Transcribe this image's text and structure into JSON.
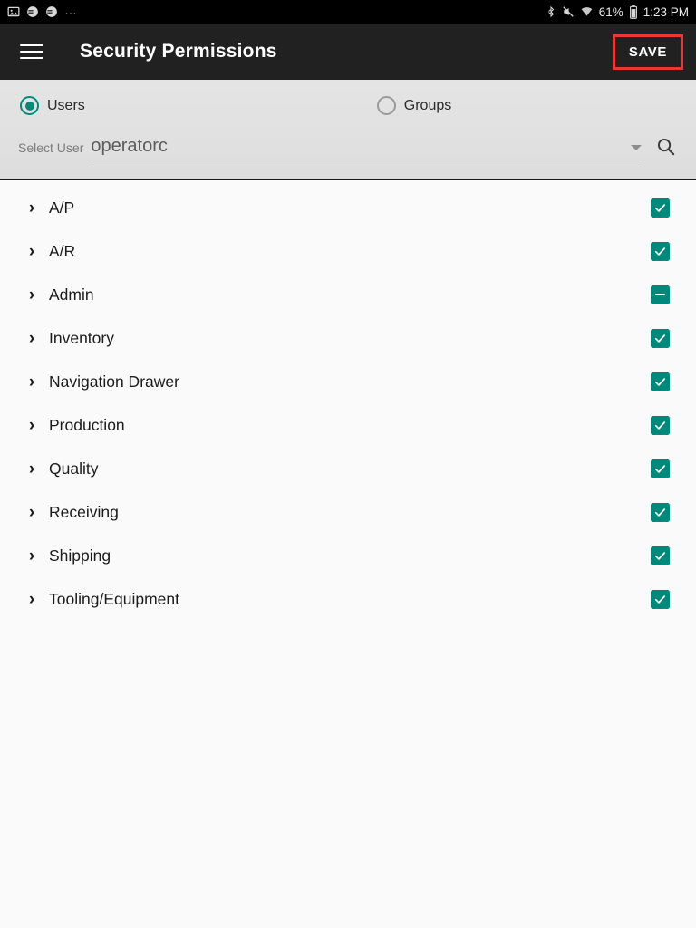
{
  "status_bar": {
    "left_icons": [
      "image-icon",
      "app-notification-icon",
      "app-notification-icon"
    ],
    "overflow_dots": "…",
    "right_icons": [
      "bluetooth-icon",
      "vibrate-mute-icon",
      "wifi-icon"
    ],
    "battery_percent": "61%",
    "time": "1:23 PM"
  },
  "app_bar": {
    "menu_icon": "hamburger-menu-icon",
    "title": "Security Permissions",
    "save_label": "SAVE",
    "highlight_color": "#e53935",
    "background": "#212121"
  },
  "selector": {
    "radio_users": {
      "label": "Users",
      "selected": true
    },
    "radio_groups": {
      "label": "Groups",
      "selected": false
    },
    "select_user_label": "Select User",
    "selected_user": "operatorc",
    "dropdown_icon": "chevron-down-icon",
    "search_icon": "search-icon",
    "accent_color": "#00897b"
  },
  "permissions": {
    "accent_color": "#00897b",
    "rows": [
      {
        "label": "A/P",
        "state": "checked",
        "expand_icon": "chevron-right-icon"
      },
      {
        "label": "A/R",
        "state": "checked",
        "expand_icon": "chevron-right-icon"
      },
      {
        "label": "Admin",
        "state": "indeterminate",
        "expand_icon": "chevron-right-icon"
      },
      {
        "label": "Inventory",
        "state": "checked",
        "expand_icon": "chevron-right-icon"
      },
      {
        "label": "Navigation Drawer",
        "state": "checked",
        "expand_icon": "chevron-right-icon"
      },
      {
        "label": "Production",
        "state": "checked",
        "expand_icon": "chevron-right-icon"
      },
      {
        "label": "Quality",
        "state": "checked",
        "expand_icon": "chevron-right-icon"
      },
      {
        "label": "Receiving",
        "state": "checked",
        "expand_icon": "chevron-right-icon"
      },
      {
        "label": "Shipping",
        "state": "checked",
        "expand_icon": "chevron-right-icon"
      },
      {
        "label": "Tooling/Equipment",
        "state": "checked",
        "expand_icon": "chevron-right-icon"
      }
    ]
  }
}
